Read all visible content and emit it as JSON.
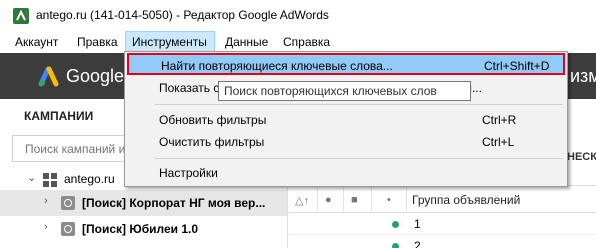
{
  "window": {
    "title": "antego.ru (141-014-5050) - Редактор Google AdWords"
  },
  "menubar": {
    "items": [
      "Аккаунт",
      "Правка",
      "Инструменты",
      "Данные",
      "Справка"
    ]
  },
  "header": {
    "logo_text": "Google",
    "right_text": "изм"
  },
  "left_panel": {
    "title": "КАМПАНИИ",
    "search_placeholder": "Поиск кампаний и",
    "tree": [
      {
        "label": "antego.ru"
      },
      {
        "label": "[Поиск] Корпорат НГ моя вер..."
      },
      {
        "label": "[Поиск] Юбилеи 1.0"
      }
    ]
  },
  "right_panel": {
    "column_header_partial": "НЕСК",
    "table_header_label": "Группа объявлений",
    "rows": [
      "1",
      "2"
    ]
  },
  "dropdown": {
    "items": [
      {
        "label": "Найти повторяющиеся ключевые слова...",
        "shortcut": "Ctrl+Shift+D"
      },
      {
        "label": "Показать с",
        "shortcut": "",
        "trailing": "ми..."
      },
      {
        "label": "Обновить фильтры",
        "shortcut": "Ctrl+R"
      },
      {
        "label": "Очистить фильтры",
        "shortcut": "Ctrl+L"
      },
      {
        "label": "Настройки",
        "shortcut": ""
      }
    ]
  },
  "tooltip": {
    "text": "Поиск повторяющихся ключевых слов"
  },
  "colors": {
    "menu_highlight": "#91c9f7",
    "highlight_border": "#e3001b",
    "header_bg": "#3c3c3c",
    "status_dot": "#1fa07a"
  }
}
